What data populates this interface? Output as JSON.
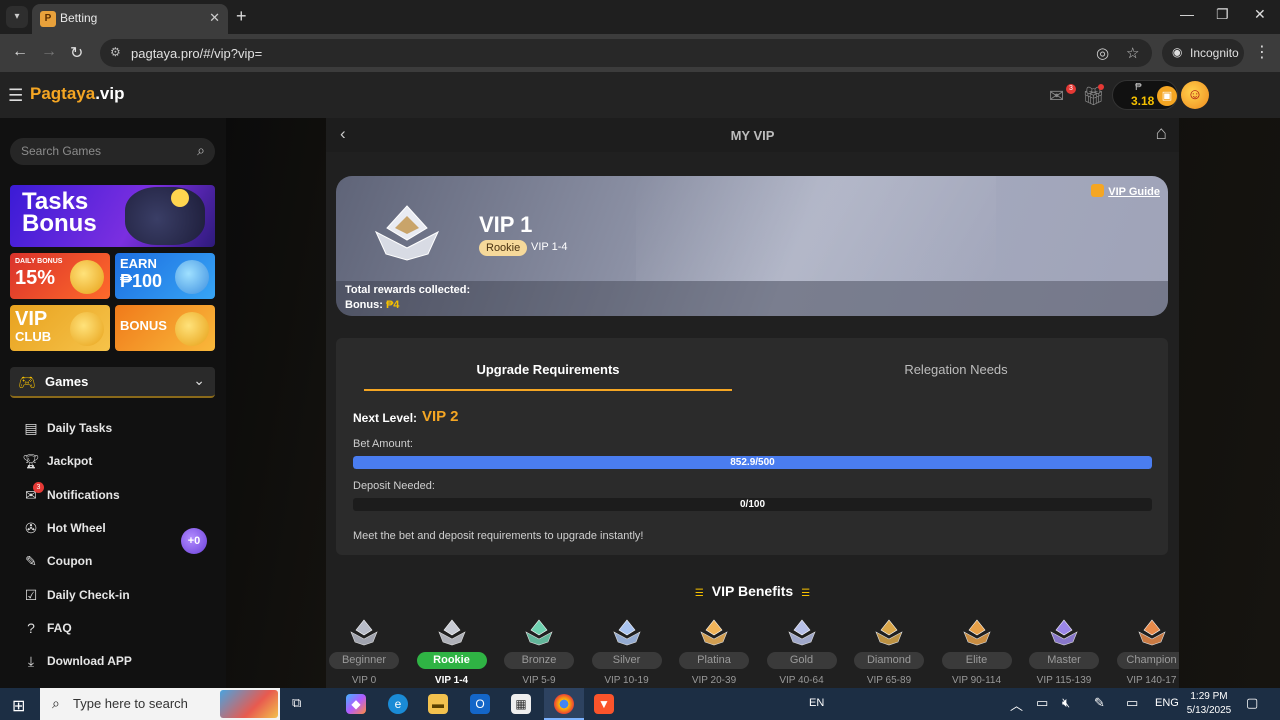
{
  "browser": {
    "tab_title": "Betting",
    "url": "pagtaya.pro/#/vip?vip=",
    "incognito_label": "Incognito"
  },
  "site": {
    "logo_part1": "Pagtaya",
    "logo_part2": ".vip",
    "mail_badge": "3",
    "wallet_currency": "₱",
    "wallet_amount": "3.18"
  },
  "sidebar": {
    "search_placeholder": "Search Games",
    "promos": {
      "tasks_line1": "Tasks",
      "tasks_line2": "Bonus",
      "daily_small": "DAILY BONUS",
      "daily_big": "15%",
      "earn_small": "EARN",
      "earn_big": "₱100",
      "vip_line1": "VIP",
      "vip_line2": "CLUB",
      "bonus_big": "BONUS"
    },
    "games_label": "Games",
    "menu": [
      {
        "label": "Daily Tasks",
        "icon": "tasks-icon"
      },
      {
        "label": "Jackpot",
        "icon": "trophy-icon"
      },
      {
        "label": "Notifications",
        "icon": "mail-icon",
        "badge": "3"
      },
      {
        "label": "Hot Wheel",
        "icon": "wheel-icon"
      },
      {
        "label": "Coupon",
        "icon": "coupon-icon"
      },
      {
        "label": "Daily Check-in",
        "icon": "checkin-icon"
      },
      {
        "label": "FAQ",
        "icon": "help-icon"
      },
      {
        "label": "Download APP",
        "icon": "download-icon"
      }
    ],
    "float_btn": "+0"
  },
  "vip_page": {
    "title": "MY VIP",
    "vip_guide": "VIP Guide",
    "level": "VIP 1",
    "tier_pill": "Rookie",
    "tier_range": "VIP 1-4",
    "rewards_label": "Total rewards collected:",
    "bonus_label": "Bonus:",
    "bonus_value": "₱4",
    "tabs": {
      "upgrade": "Upgrade Requirements",
      "relegation": "Relegation Needs"
    },
    "next_level_label": "Next Level:",
    "next_level_value": "VIP 2",
    "bet_label": "Bet Amount:",
    "bet_text": "852.9/500",
    "bet_progress": 1.0,
    "deposit_label": "Deposit Needed:",
    "deposit_text": "0/100",
    "deposit_progress": 0.0,
    "note": "Meet the bet and deposit requirements to upgrade instantly!",
    "benefits_title": "VIP Benefits",
    "tiers": [
      {
        "name": "Beginner",
        "range": "VIP 0",
        "color": "#b8bcc8"
      },
      {
        "name": "Rookie",
        "range": "VIP 1-4",
        "color": "#c8cbd4",
        "current": true
      },
      {
        "name": "Bronze",
        "range": "VIP 5-9",
        "color": "#6fd1b0"
      },
      {
        "name": "Silver",
        "range": "VIP 10-19",
        "color": "#a9c4f0"
      },
      {
        "name": "Platina",
        "range": "VIP 20-39",
        "color": "#f0b45a"
      },
      {
        "name": "Gold",
        "range": "VIP 40-64",
        "color": "#b7c0e8"
      },
      {
        "name": "Diamond",
        "range": "VIP 65-89",
        "color": "#d9a64a"
      },
      {
        "name": "Elite",
        "range": "VIP 90-114",
        "color": "#e7a048"
      },
      {
        "name": "Master",
        "range": "VIP 115-139",
        "color": "#9b87e8"
      },
      {
        "name": "Champion",
        "range": "VIP 140-17",
        "color": "#e88a4a"
      }
    ]
  },
  "taskbar": {
    "search_text": "Type here to search",
    "lang": "EN",
    "lang2": "ENG",
    "time": "1:29 PM",
    "date": "5/13/2025"
  }
}
